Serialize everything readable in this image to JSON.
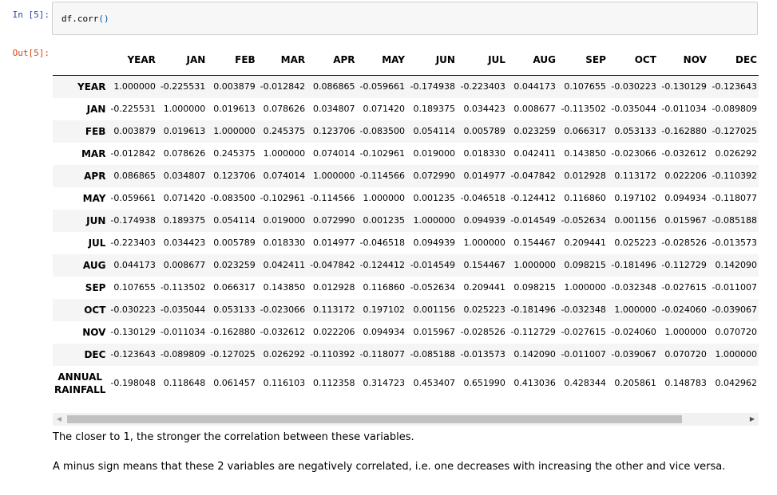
{
  "cells": {
    "input_prompt": "In [5]:",
    "output_prompt": "Out[5]:",
    "code_name": "df.corr",
    "code_parens": "()"
  },
  "table": {
    "columns": [
      "YEAR",
      "JAN",
      "FEB",
      "MAR",
      "APR",
      "MAY",
      "JUN",
      "JUL",
      "AUG",
      "SEP",
      "OCT",
      "NOV",
      "DEC"
    ],
    "rows": [
      {
        "label": "YEAR",
        "values": [
          "1.000000",
          "-0.225531",
          "0.003879",
          "-0.012842",
          "0.086865",
          "-0.059661",
          "-0.174938",
          "-0.223403",
          "0.044173",
          "0.107655",
          "-0.030223",
          "-0.130129",
          "-0.123643"
        ]
      },
      {
        "label": "JAN",
        "values": [
          "-0.225531",
          "1.000000",
          "0.019613",
          "0.078626",
          "0.034807",
          "0.071420",
          "0.189375",
          "0.034423",
          "0.008677",
          "-0.113502",
          "-0.035044",
          "-0.011034",
          "-0.089809"
        ]
      },
      {
        "label": "FEB",
        "values": [
          "0.003879",
          "0.019613",
          "1.000000",
          "0.245375",
          "0.123706",
          "-0.083500",
          "0.054114",
          "0.005789",
          "0.023259",
          "0.066317",
          "0.053133",
          "-0.162880",
          "-0.127025"
        ]
      },
      {
        "label": "MAR",
        "values": [
          "-0.012842",
          "0.078626",
          "0.245375",
          "1.000000",
          "0.074014",
          "-0.102961",
          "0.019000",
          "0.018330",
          "0.042411",
          "0.143850",
          "-0.023066",
          "-0.032612",
          "0.026292"
        ]
      },
      {
        "label": "APR",
        "values": [
          "0.086865",
          "0.034807",
          "0.123706",
          "0.074014",
          "1.000000",
          "-0.114566",
          "0.072990",
          "0.014977",
          "-0.047842",
          "0.012928",
          "0.113172",
          "0.022206",
          "-0.110392"
        ]
      },
      {
        "label": "MAY",
        "values": [
          "-0.059661",
          "0.071420",
          "-0.083500",
          "-0.102961",
          "-0.114566",
          "1.000000",
          "0.001235",
          "-0.046518",
          "-0.124412",
          "0.116860",
          "0.197102",
          "0.094934",
          "-0.118077"
        ]
      },
      {
        "label": "JUN",
        "values": [
          "-0.174938",
          "0.189375",
          "0.054114",
          "0.019000",
          "0.072990",
          "0.001235",
          "1.000000",
          "0.094939",
          "-0.014549",
          "-0.052634",
          "0.001156",
          "0.015967",
          "-0.085188"
        ]
      },
      {
        "label": "JUL",
        "values": [
          "-0.223403",
          "0.034423",
          "0.005789",
          "0.018330",
          "0.014977",
          "-0.046518",
          "0.094939",
          "1.000000",
          "0.154467",
          "0.209441",
          "0.025223",
          "-0.028526",
          "-0.013573"
        ]
      },
      {
        "label": "AUG",
        "values": [
          "0.044173",
          "0.008677",
          "0.023259",
          "0.042411",
          "-0.047842",
          "-0.124412",
          "-0.014549",
          "0.154467",
          "1.000000",
          "0.098215",
          "-0.181496",
          "-0.112729",
          "0.142090"
        ]
      },
      {
        "label": "SEP",
        "values": [
          "0.107655",
          "-0.113502",
          "0.066317",
          "0.143850",
          "0.012928",
          "0.116860",
          "-0.052634",
          "0.209441",
          "0.098215",
          "1.000000",
          "-0.032348",
          "-0.027615",
          "-0.011007"
        ]
      },
      {
        "label": "OCT",
        "values": [
          "-0.030223",
          "-0.035044",
          "0.053133",
          "-0.023066",
          "0.113172",
          "0.197102",
          "0.001156",
          "0.025223",
          "-0.181496",
          "-0.032348",
          "1.000000",
          "-0.024060",
          "-0.039067"
        ]
      },
      {
        "label": "NOV",
        "values": [
          "-0.130129",
          "-0.011034",
          "-0.162880",
          "-0.032612",
          "0.022206",
          "0.094934",
          "0.015967",
          "-0.028526",
          "-0.112729",
          "-0.027615",
          "-0.024060",
          "1.000000",
          "0.070720"
        ]
      },
      {
        "label": "DEC",
        "values": [
          "-0.123643",
          "-0.089809",
          "-0.127025",
          "0.026292",
          "-0.110392",
          "-0.118077",
          "-0.085188",
          "-0.013573",
          "0.142090",
          "-0.011007",
          "-0.039067",
          "0.070720",
          "1.000000"
        ]
      },
      {
        "label": "ANNUAL RAINFALL",
        "label_lines": [
          "ANNUAL",
          "RAINFALL"
        ],
        "values": [
          "-0.198048",
          "0.118648",
          "0.061457",
          "0.116103",
          "0.112358",
          "0.314723",
          "0.453407",
          "0.651990",
          "0.413036",
          "0.428344",
          "0.205861",
          "0.148783",
          "0.042962"
        ]
      }
    ]
  },
  "scrollbar": {
    "left_arrow": "◀",
    "right_arrow": "▶"
  },
  "notes": {
    "first": "The closer to 1, the stronger the correlation between these variables.",
    "second": "A minus sign means that these 2 variables are negatively correlated, i.e. one decreases with increasing the other and vice versa."
  }
}
